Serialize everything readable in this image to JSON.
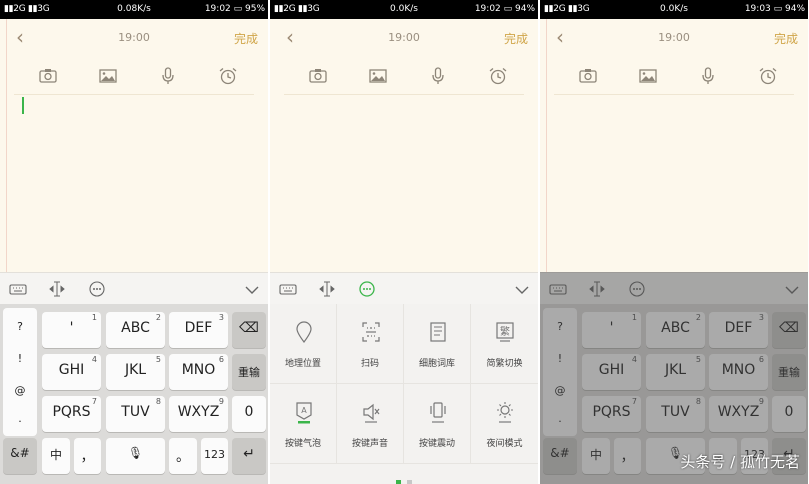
{
  "screens": [
    {
      "status": {
        "signal": "▮▮2G ▮▮3G",
        "speed": "0.08K/s",
        "time_battery": "19:02 ▭ 95%"
      },
      "header": {
        "time": "19:00",
        "done": "完成"
      },
      "keyboard": {
        "symbols": [
          "?",
          "!",
          "@",
          "."
        ],
        "keys": [
          {
            "main": "'",
            "num": "1"
          },
          {
            "main": "ABC",
            "num": "2"
          },
          {
            "main": "DEF",
            "num": "3"
          },
          {
            "main": "GHI",
            "num": "4"
          },
          {
            "main": "JKL",
            "num": "5"
          },
          {
            "main": "MNO",
            "num": "6"
          },
          {
            "main": "PQRS",
            "num": "7"
          },
          {
            "main": "TUV",
            "num": "8"
          },
          {
            "main": "WXYZ",
            "num": "9"
          }
        ],
        "backspace": "⌫",
        "reenter": "重输",
        "zero": "0",
        "bottom": {
          "sym": "&#",
          "chinese": "中",
          "comma": "，",
          "mic": "🎙",
          "period": "。",
          "num123": "123",
          "enter": "↵"
        }
      }
    },
    {
      "status": {
        "signal": "▮▮2G ▮▮3G",
        "speed": "0.0K/s",
        "time_battery": "19:02 ▭ 94%"
      },
      "header": {
        "time": "19:00",
        "done": "完成"
      },
      "panel": {
        "items": [
          "地理位置",
          "扫码",
          "细胞词库",
          "简繁切换",
          "按键气泡",
          "按键声音",
          "按键震动",
          "夜间模式"
        ]
      }
    },
    {
      "status": {
        "signal": "▮▮2G ▮▮3G",
        "speed": "0.0K/s",
        "time_battery": "19:03 ▭ 94%"
      },
      "header": {
        "time": "19:00",
        "done": "完成"
      },
      "watermark": "头条号 / 孤竹无茗"
    }
  ],
  "colors": {
    "accent_gold": "#d0a548",
    "accent_green": "#3bb54a",
    "note_bg": "#fdf8ec"
  },
  "icons": [
    "back-chevron-icon",
    "camera-icon",
    "image-icon",
    "microphone-icon",
    "alarm-clock-icon",
    "keyboard-icon",
    "text-cursor-icon",
    "more-icon",
    "collapse-chevron-icon"
  ]
}
